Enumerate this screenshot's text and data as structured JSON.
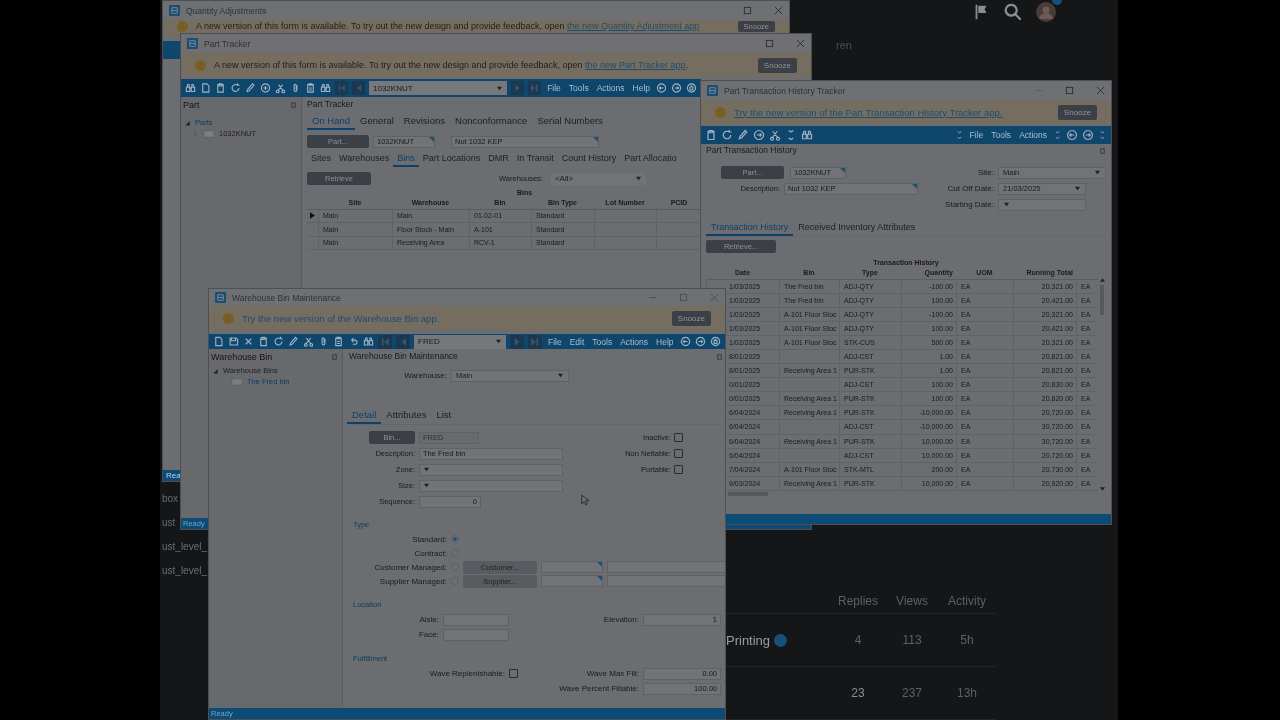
{
  "forum": {
    "fragment": "ren",
    "side_texts": [
      "box",
      "ust",
      "ust_level_",
      "ust_level_"
    ],
    "columns": [
      "Replies",
      "Views",
      "Activity"
    ],
    "topics": [
      {
        "title": "Printing",
        "cells": [
          "4",
          "113",
          "5h"
        ]
      },
      {
        "cells": [
          "23",
          "237",
          "13h"
        ]
      }
    ]
  },
  "quantity_adjustments": {
    "title": "Quantity Adjustments",
    "banner": "A new version of this form is available. To try out the new design and provide feedback, open ",
    "banner_link": "the new Quantity Adjustment app",
    "snooze": "Snooze",
    "status": "Rea"
  },
  "part_tracker": {
    "title": "Part Tracker",
    "banner": "A new version of this form is available. To try out the new design and provide feedback, open ",
    "banner_link": "the new Part Tracker app",
    "banner_end": ".",
    "snooze": "Snooze",
    "record": "1032KNUT",
    "menu": [
      "File",
      "Tools",
      "Actions",
      "Help"
    ],
    "tree_title": "Part",
    "tree": [
      {
        "label": "Parts",
        "expanded": true,
        "children": [
          {
            "label": "1032KNUT",
            "expanded": false
          }
        ]
      }
    ],
    "heading": "Part Tracker",
    "tabs": [
      {
        "label": "On Hand",
        "selected": true
      },
      {
        "label": "General",
        "selected": false
      },
      {
        "label": "Revisions",
        "selected": false
      },
      {
        "label": "Nonconformance",
        "selected": false
      },
      {
        "label": "Serial Numbers",
        "selected": false
      }
    ],
    "part_button": "Part...",
    "part": "1032KNUT",
    "description": "Nut 1032 KEP",
    "subtabs": [
      {
        "label": "Sites",
        "selected": false
      },
      {
        "label": "Warehouses",
        "selected": false
      },
      {
        "label": "Bins",
        "selected": true
      },
      {
        "label": "Part Locations",
        "selected": false
      },
      {
        "label": "DMR",
        "selected": false
      },
      {
        "label": "In Transit",
        "selected": false
      },
      {
        "label": "Count History",
        "selected": false
      },
      {
        "label": "Part Allocatio",
        "selected": false
      }
    ],
    "retrieve": "Retrieve",
    "warehouses_label": "Warehouses:",
    "warehouses": "<All>",
    "grid": {
      "title": "Bins",
      "columns": [
        "Site",
        "Warehouse",
        "Bin",
        "Bin Type",
        "Lot Number",
        "PCID"
      ],
      "rows": [
        {
          "current": true,
          "cells": [
            "Main",
            "Main",
            "01-02-01",
            "Standard"
          ]
        },
        {
          "current": false,
          "cells": [
            "Main",
            "Floor Stock - Main",
            "A-101",
            "Standard"
          ]
        },
        {
          "current": false,
          "cells": [
            "Main",
            "Receiving Area",
            "RCV-1",
            "Standard"
          ]
        }
      ]
    },
    "status": "Ready"
  },
  "transaction_history": {
    "title": "Part Transaction History Tracker",
    "banner_link": "Try the new version of the Part Transaction History Tracker app.",
    "snooze": "Snooze",
    "menu": [
      "File",
      "Tools",
      "Actions"
    ],
    "heading": "Part Transaction History",
    "part_button": "Part...",
    "part": "1032KNUT",
    "description_label": "Description:",
    "description": "Nut 1032 KEP",
    "site_label": "Site:",
    "site": "Main",
    "cutoff_label": "Cut Off Date:",
    "cutoff": "21/03/2025",
    "start_label": "Starting Date:",
    "tabs": [
      {
        "label": "Transaction History",
        "selected": true
      },
      {
        "label": "Received Inventory Attributes",
        "selected": false
      }
    ],
    "retrieve": "Retrieve...",
    "grid": {
      "title": "Transaction History",
      "columns": [
        "Date",
        "Bin",
        "Type",
        "Quantity",
        "UOM",
        "Running Total"
      ],
      "rows": [
        {
          "date": "1/03/2025",
          "bin": "The Fred bin",
          "type": "ADJ-QTY",
          "quantity": "-100.00",
          "uom": "EA",
          "running_total": "20,321.00",
          "col_7": "EA"
        },
        {
          "date": "1/03/2025",
          "bin": "The Fred bin",
          "type": "ADJ-QTY",
          "quantity": "100.00",
          "uom": "EA",
          "running_total": "20,421.00",
          "col_7": "EA"
        },
        {
          "date": "1/03/2025",
          "bin": "A-101 Floor Stoc",
          "type": "ADJ-QTY",
          "quantity": "-100.00",
          "uom": "EA",
          "running_total": "20,321.00",
          "col_7": "EA"
        },
        {
          "date": "1/03/2025",
          "bin": "A-101 Floor Stoc",
          "type": "ADJ-QTY",
          "quantity": "100.00",
          "uom": "EA",
          "running_total": "20,421.00",
          "col_7": "EA"
        },
        {
          "date": "1/02/2025",
          "bin": "A-101 Floor Stoc",
          "type": "STK-CUS",
          "quantity": "500.00",
          "uom": "EA",
          "running_total": "20,321.00",
          "col_7": "EA"
        },
        {
          "date": "8/01/2025",
          "type": "ADJ-CST",
          "quantity": "1.00",
          "uom": "EA",
          "running_total": "20,821.00",
          "col_7": "EA"
        },
        {
          "date": "8/01/2025",
          "bin": "Receiving Area 1",
          "type": "PUR-STK",
          "quantity": "1.00",
          "uom": "EA",
          "running_total": "20,821.00",
          "col_7": "EA"
        },
        {
          "date": "0/01/2025",
          "type": "ADJ-CST",
          "quantity": "100.00",
          "uom": "EA",
          "running_total": "20,830.00",
          "col_7": "EA"
        },
        {
          "date": "0/01/2025",
          "bin": "Receiving Area 1",
          "type": "PUR-STK",
          "quantity": "100.00",
          "uom": "EA",
          "running_total": "20,820.00",
          "col_7": "EA"
        },
        {
          "date": "6/04/2024",
          "bin": "Receiving Area 1",
          "type": "PUR-STK",
          "quantity": "-10,000.00",
          "uom": "EA",
          "running_total": "20,720.00",
          "col_7": "EA"
        },
        {
          "date": "6/04/2024",
          "type": "ADJ-CST",
          "quantity": "-10,000.00",
          "uom": "EA",
          "running_total": "30,720.00",
          "col_7": "EA"
        },
        {
          "date": "6/04/2024",
          "bin": "Receiving Area 1",
          "type": "PUR-STK",
          "quantity": "10,000.00",
          "uom": "EA",
          "running_total": "30,720.00",
          "col_7": "EA"
        },
        {
          "date": "6/04/2024",
          "type": "ADJ-CST",
          "quantity": "10,000.00",
          "uom": "EA",
          "running_total": "20,720.00",
          "col_7": "EA"
        },
        {
          "date": "7/04/2024",
          "bin": "A-101 Floor Stoc",
          "type": "STK-MTL",
          "quantity": "200.00",
          "uom": "EA",
          "running_total": "20,730.00",
          "col_7": "EA"
        },
        {
          "date": "9/03/2024",
          "bin": "Receiving Area 1",
          "type": "PUR-STK",
          "quantity": "10,000.00",
          "uom": "EA",
          "running_total": "20,920.00",
          "col_7": "EA"
        }
      ]
    }
  },
  "warehouse_bin": {
    "title": "Warehouse Bin Maintenance",
    "banner_link": "Try the new version of the Warehouse Bin app.",
    "snooze": "Snooze",
    "record": "FRED",
    "menu": [
      "File",
      "Edit",
      "Tools",
      "Actions",
      "Help"
    ],
    "tree_title": "Warehouse Bin",
    "tree": [
      {
        "label": "Warehouse Bins",
        "expanded": true,
        "children": [
          {
            "label": "The Fred bin",
            "selected": true
          }
        ]
      }
    ],
    "heading": "Warehouse Bin Maintenance",
    "warehouse_label": "Warehouse:",
    "warehouse": "Main",
    "tabs": [
      {
        "label": "Detail",
        "selected": true
      },
      {
        "label": "Attributes",
        "selected": false
      },
      {
        "label": "List",
        "selected": false
      }
    ],
    "bin_button": "Bin...",
    "bin": "FRED",
    "bin_disabled": true,
    "description_label": "Description:",
    "description": "The Fred bin",
    "zone_label": "Zone:",
    "size_label": "Size:",
    "sequence_label": "Sequence:",
    "sequence": "0",
    "flags": [
      {
        "label": "Inactive:",
        "checked": false
      },
      {
        "label": "Non Nettable:",
        "checked": false
      },
      {
        "label": "Portable:",
        "checked": false
      }
    ],
    "type_section": "Type",
    "types": [
      {
        "label": "Standard:",
        "selected": true
      },
      {
        "label": "Contract:",
        "selected": false
      },
      {
        "label": "Customer Managed:",
        "selected": false,
        "button": "Customer...",
        "button_disabled": true
      },
      {
        "label": "Supplier Managed:",
        "selected": false,
        "button": "Supplier...",
        "button_disabled": true
      }
    ],
    "location_section": "Location",
    "aisle_label": "Aisle:",
    "face_label": "Face:",
    "elevation_label": "Elevation:",
    "elevation": "1",
    "fulfillment_section": "Fulfillment",
    "wave_replenishable": {
      "label": "Wave Replenishable:",
      "checked": false
    },
    "wave_max_fill_label": "Wave Max Fill:",
    "wave_max_fill": "0.00",
    "wave_percent_label": "Wave Percent Fillable:",
    "wave_percent": "100.00",
    "status": "Ready"
  }
}
